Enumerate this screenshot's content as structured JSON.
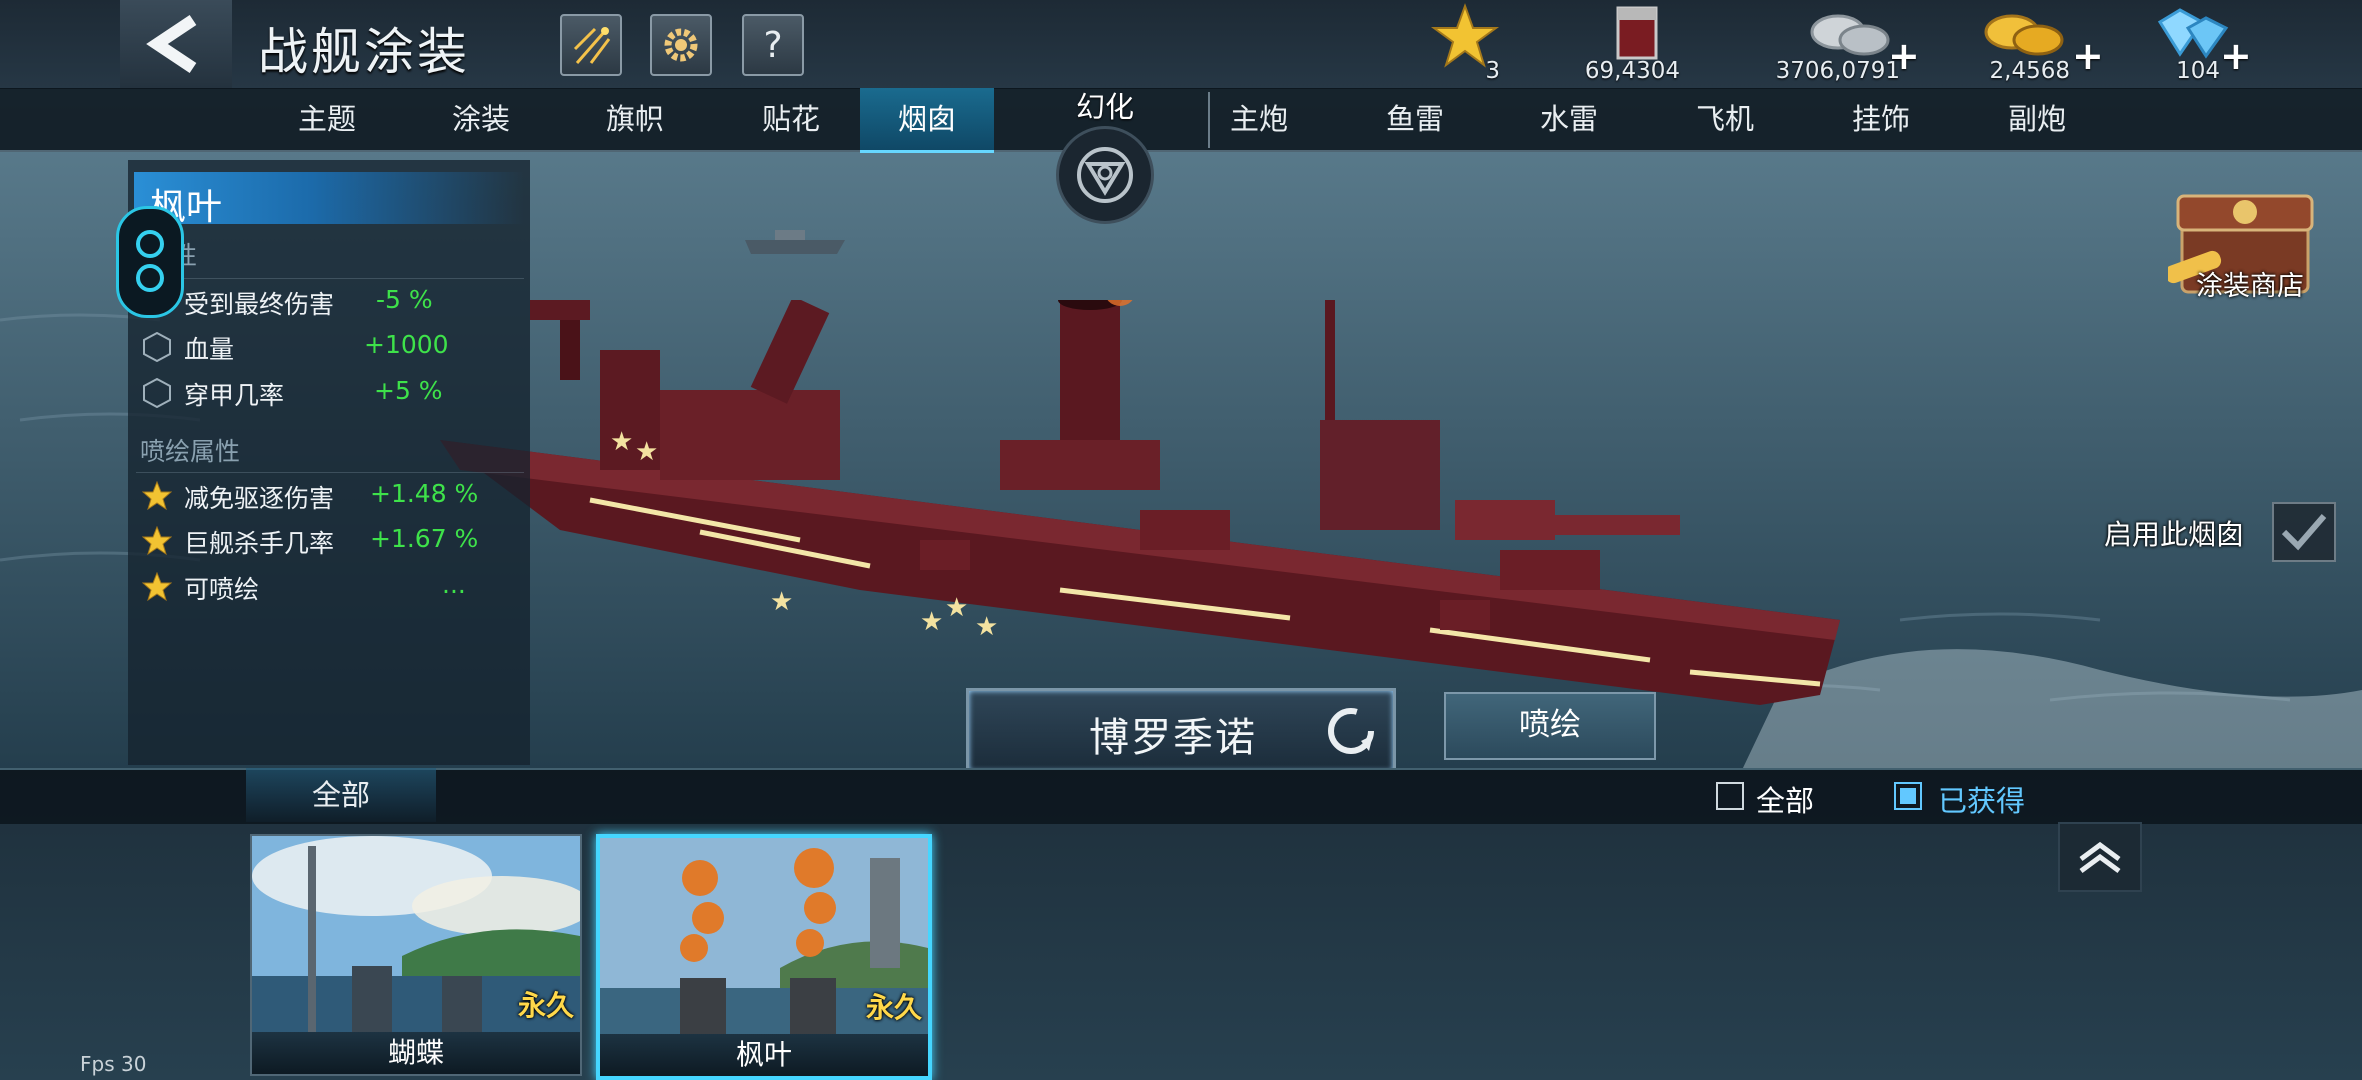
{
  "header": {
    "title": "战舰涂装",
    "resources": [
      {
        "icon": "star-icon",
        "value": "3",
        "plus": false
      },
      {
        "icon": "paint-bucket-icon",
        "value": "69,4304",
        "plus": false
      },
      {
        "icon": "silver-coins-icon",
        "value": "3706,0791",
        "plus": true
      },
      {
        "icon": "gold-coins-icon",
        "value": "2,4568",
        "plus": true
      },
      {
        "icon": "diamond-icon",
        "value": "104",
        "plus": true
      }
    ]
  },
  "tabs": {
    "items": [
      "主题",
      "涂装",
      "旗帜",
      "贴花",
      "烟囱",
      "主炮",
      "鱼雷",
      "水雷",
      "飞机",
      "挂饰",
      "副炮"
    ],
    "active": "烟囱",
    "huanhua": "幻化"
  },
  "panel": {
    "skin_name": "枫叶",
    "section1": "性",
    "attrs": [
      {
        "name": "受到最终伤害",
        "value": "-5 %"
      },
      {
        "name": "血量",
        "value": "+1000"
      },
      {
        "name": "穿甲几率",
        "value": "+5 %"
      }
    ],
    "section2": "喷绘属性",
    "spray_attrs": [
      {
        "name": "减免驱逐伤害",
        "value": "+1.48 %"
      },
      {
        "name": "巨舰杀手几率",
        "value": "+1.67 %"
      },
      {
        "name": "可喷绘",
        "value": "..."
      }
    ]
  },
  "right": {
    "shop_label": "涂装商店",
    "enable_label": "启用此烟囱"
  },
  "ship": {
    "name": "博罗季诺",
    "spray_button": "喷绘"
  },
  "bottom": {
    "filter_tab": "全部",
    "check_all": "全部",
    "check_owned": "已获得",
    "cards": [
      {
        "name": "蝴蝶",
        "tag": "永久",
        "selected": false
      },
      {
        "name": "枫叶",
        "tag": "永久",
        "selected": true
      }
    ]
  },
  "fps": "Fps 30",
  "colors": {
    "active_tab": "#0f4866",
    "stat_green": "#3ee24a",
    "permanent_tag": "#ffd84a",
    "selection": "#45d6ff"
  }
}
